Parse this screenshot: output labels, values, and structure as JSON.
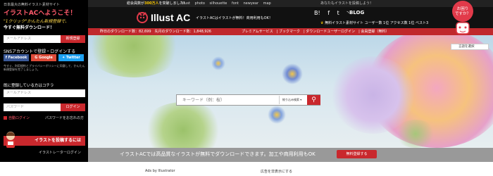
{
  "topbar": {
    "sidebar_small": "日本最大の無料イラスト素材サイト",
    "notice_prefix": "総会員数が",
    "notice_count": "300万人",
    "notice_suffix": "を突破しました！",
    "site_links": [
      "illust",
      "photo",
      "silhouette",
      "font",
      "newyear",
      "map"
    ],
    "right_text": "あなたもイラストを投稿しよう！"
  },
  "header": {
    "logo": "Illust AC",
    "tagline": "イラストACはイラストが無料！商用利用もOK！",
    "social": [
      "B!",
      "f",
      "t",
      "rss"
    ],
    "blog": "BLOG",
    "user_links": "無料イラスト素材サイト ユーザー数 1位 アクセス数 1位 ベスト3"
  },
  "statsbar": {
    "downloads": "昨日のダウンロード数：82,699　先月のダウンロード数：1,848,926",
    "menu": [
      "プレミアムサービス",
      "ブックマーク",
      "ダウンロードユーザーログイン",
      "会員登録（無料）"
    ]
  },
  "sidebar": {
    "welcome": "イラストACへようこそ！",
    "promo1": "\"1クリック\"かんたん新規登録で、",
    "promo2": "今すぐ無料ダウンロード！",
    "email_placeholder": "メールアドレス",
    "register_button": "新規登録",
    "sns_heading": "SNSアカウントで登録・ログインする",
    "facebook": "Facebook",
    "google": "Google",
    "twitter": "Twitter",
    "note": "今すぐ、利用規約とプライバシーポリシーに同意して、かんたん新規登録を完了しましょう。",
    "login_heading": "既に登録している方はコチラ",
    "login_email_placeholder": "メールアドレス",
    "password_placeholder": "パスワード",
    "login_button": "ログイン",
    "auto_login": "自動ログイン",
    "forgot": "パスワードをお忘れの方",
    "post_button": "イラストを投稿するには",
    "creator_login": "イラストレーターログイン"
  },
  "search": {
    "placeholder": "キーワード（例：桜）",
    "filter": "絞り込み検索",
    "button_icon": "search-icon"
  },
  "language": "言語を選択",
  "band": {
    "text": "イラストACでは高品質なイラストが無料でダウンロードできます。加工や商用利用もOK",
    "button": "無料登録する"
  },
  "below": {
    "ads": "Ads by Illustrator",
    "report": "広告を非表示にする"
  },
  "character": {
    "speech": "お困りですか？"
  },
  "colors": {
    "accent_red": "#c9282d",
    "header_black": "#111111",
    "stats_red": "#c0282c"
  }
}
